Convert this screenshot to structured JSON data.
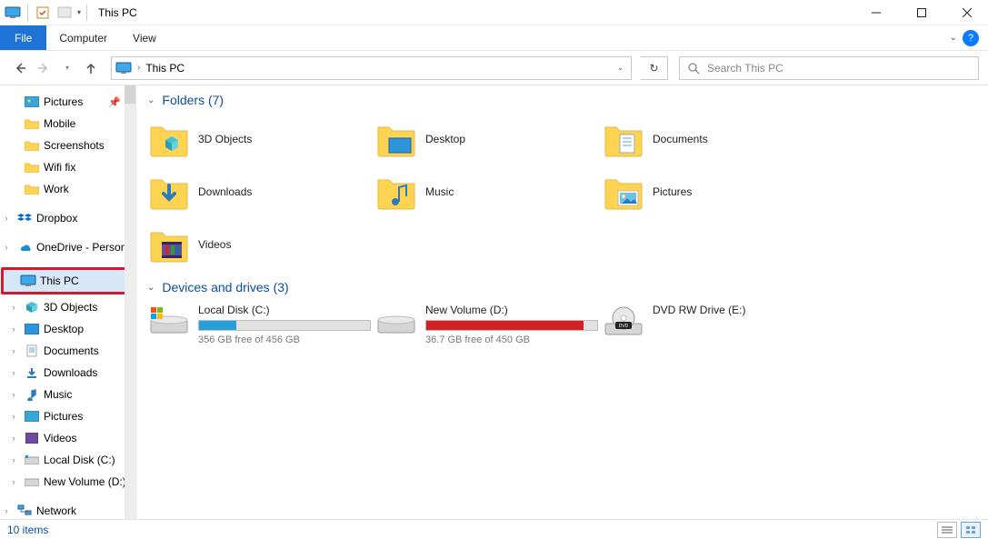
{
  "window": {
    "title": "This PC"
  },
  "ribbon": {
    "file_tab": "File",
    "tabs": [
      "Computer",
      "View"
    ]
  },
  "address": {
    "location": "This PC",
    "search_placeholder": "Search This PC"
  },
  "tree": {
    "quick": [
      {
        "label": "Pictures",
        "icon": "pictures",
        "pinned": true
      },
      {
        "label": "Mobile",
        "icon": "folder"
      },
      {
        "label": "Screenshots",
        "icon": "folder"
      },
      {
        "label": "Wifi fix",
        "icon": "folder"
      },
      {
        "label": "Work",
        "icon": "folder"
      }
    ],
    "roots": [
      {
        "label": "Dropbox",
        "icon": "dropbox",
        "expandable": true
      },
      {
        "label": "OneDrive - Personal",
        "icon": "onedrive",
        "expandable": true
      }
    ],
    "this_pc": {
      "label": "This PC",
      "children": [
        {
          "label": "3D Objects",
          "icon": "3dobjects",
          "expandable": true
        },
        {
          "label": "Desktop",
          "icon": "desktop",
          "expandable": true
        },
        {
          "label": "Documents",
          "icon": "documents",
          "expandable": true
        },
        {
          "label": "Downloads",
          "icon": "downloads",
          "expandable": true
        },
        {
          "label": "Music",
          "icon": "music",
          "expandable": true
        },
        {
          "label": "Pictures",
          "icon": "pictures",
          "expandable": true
        },
        {
          "label": "Videos",
          "icon": "videos",
          "expandable": true
        },
        {
          "label": "Local Disk (C:)",
          "icon": "drive",
          "expandable": true
        },
        {
          "label": "New Volume (D:)",
          "icon": "drive",
          "expandable": true
        }
      ]
    },
    "network": {
      "label": "Network",
      "expandable": true
    }
  },
  "groups": {
    "folders": {
      "heading": "Folders (7)",
      "items": [
        {
          "label": "3D Objects",
          "icon": "3dobjects"
        },
        {
          "label": "Desktop",
          "icon": "desktop"
        },
        {
          "label": "Documents",
          "icon": "documents"
        },
        {
          "label": "Downloads",
          "icon": "downloads"
        },
        {
          "label": "Music",
          "icon": "music"
        },
        {
          "label": "Pictures",
          "icon": "pictures"
        },
        {
          "label": "Videos",
          "icon": "videos"
        }
      ]
    },
    "drives": {
      "heading": "Devices and drives (3)",
      "items": [
        {
          "label": "Local Disk (C:)",
          "free_text": "356 GB free of 456 GB",
          "fill_pct": 22,
          "color": "#26a0da",
          "kind": "local"
        },
        {
          "label": "New Volume (D:)",
          "free_text": "36.7 GB free of 450 GB",
          "fill_pct": 92,
          "color": "#d42025",
          "kind": "local"
        },
        {
          "label": "DVD RW Drive (E:)",
          "kind": "dvd"
        }
      ]
    }
  },
  "status": {
    "count_text": "10 items"
  },
  "colors": {
    "file_tab_bg": "#1e73d6",
    "annotation_border": "#d11a2a",
    "group_heading": "#0b4ea2",
    "bar_blue": "#26a0da",
    "bar_red": "#d42025"
  }
}
